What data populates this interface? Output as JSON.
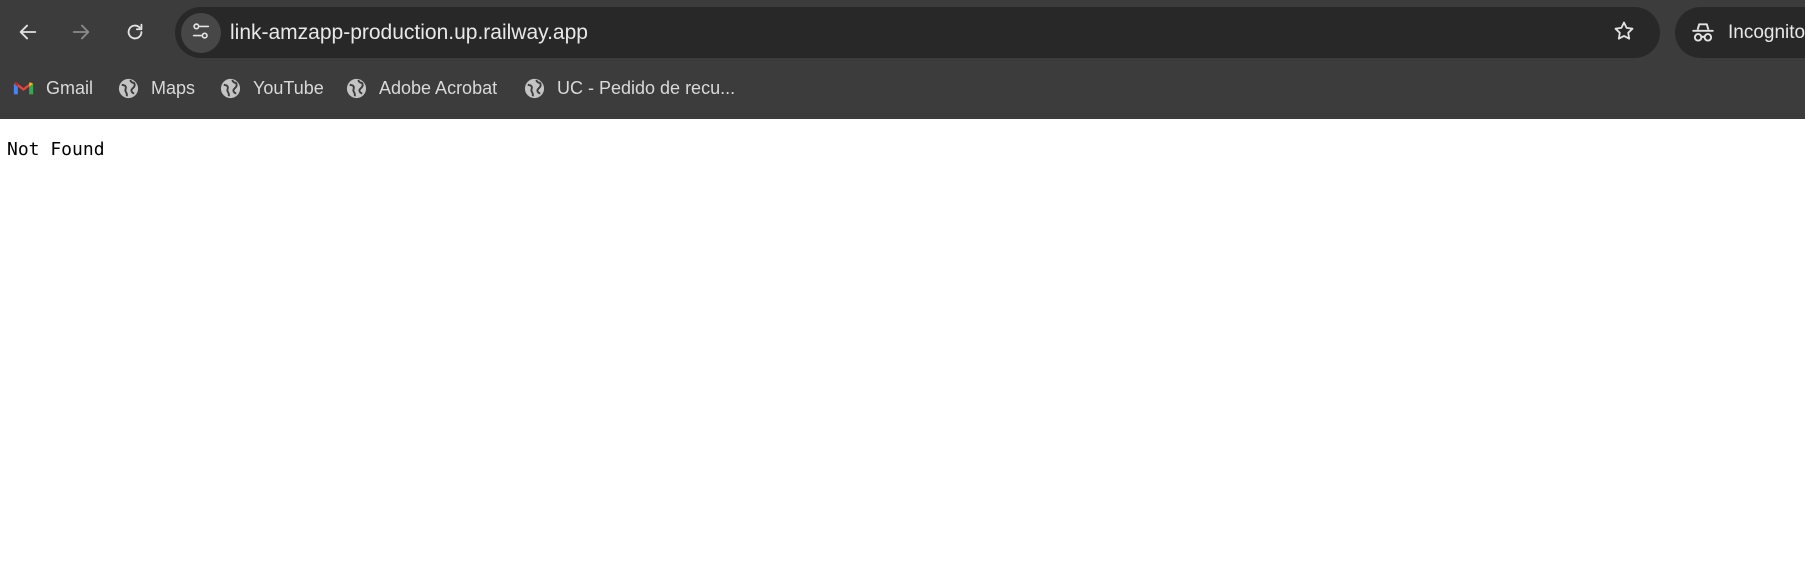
{
  "browser": {
    "url": "link-amzapp-production.up.railway.app",
    "mode_label": "Incognito",
    "bookmarks": [
      {
        "label": "Gmail",
        "icon": "gmail-icon"
      },
      {
        "label": "Maps",
        "icon": "globe-icon"
      },
      {
        "label": "YouTube",
        "icon": "globe-icon"
      },
      {
        "label": "Adobe Acrobat",
        "icon": "globe-icon"
      },
      {
        "label": "UC - Pedido de recu..."
      }
    ]
  },
  "page": {
    "message": "Not Found"
  },
  "colors": {
    "chrome_background": "#3c3c3c",
    "omnibox_background": "#282828",
    "chrome_text": "#e8e8e8",
    "page_background": "#ffffff",
    "page_text": "#000000"
  }
}
